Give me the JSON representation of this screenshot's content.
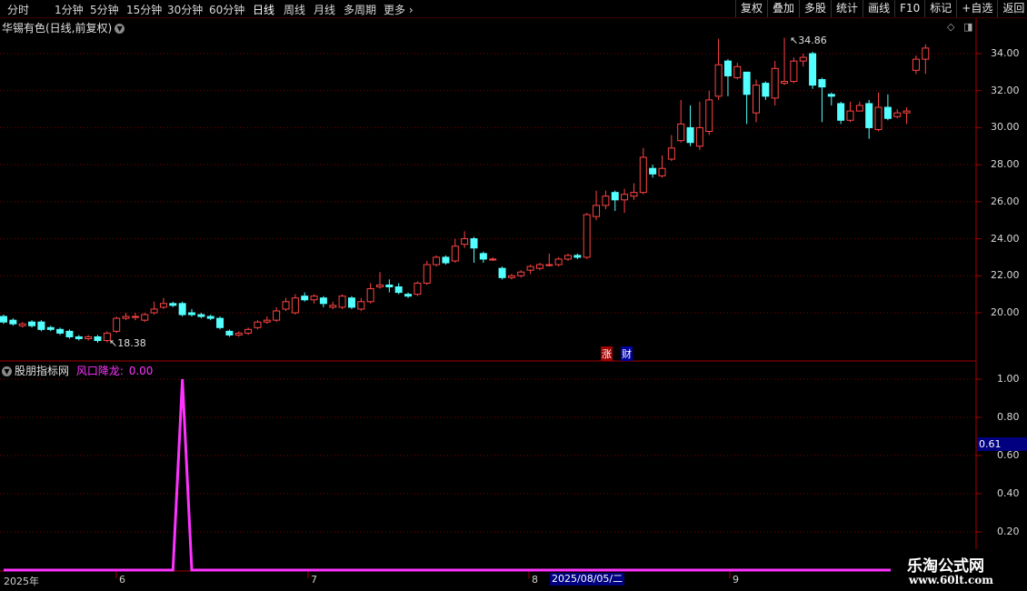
{
  "toolbar": {
    "periods": [
      "分时",
      "1分钟",
      "5分钟",
      "15分钟",
      "30分钟",
      "60分钟",
      "日线",
      "周线",
      "月线",
      "多周期",
      "更多"
    ],
    "active_period": "日线",
    "buttons": [
      "复权",
      "叠加",
      "多股",
      "统计",
      "画线",
      "F10",
      "标记",
      "+自选",
      "返回"
    ]
  },
  "chart": {
    "title": "华锡有色(日线,前复权)",
    "high_label": "34.86",
    "low_label": "18.38",
    "markers": [
      "涨",
      "财"
    ]
  },
  "price_axis": {
    "ticks": [
      "34.00",
      "32.00",
      "30.00",
      "28.00",
      "26.00",
      "24.00",
      "22.00",
      "20.00"
    ]
  },
  "indicator": {
    "source": "股朋指标网",
    "label": "风口降龙:",
    "value": "0.00",
    "axis_ticks": [
      "1.00",
      "0.80",
      "0.60",
      "0.40",
      "0.20"
    ],
    "current_value": "0.61"
  },
  "date_axis": {
    "labels": [
      "2025年",
      "6",
      "7",
      "8",
      "9"
    ],
    "current_date": "2025/08/05/二"
  },
  "watermark": {
    "title": "乐淘公式网",
    "url": "www.60lt.com"
  },
  "colors": {
    "up": "#ff4444",
    "down": "#54ffff",
    "indicator": "#ff33ff",
    "grid": "#800000"
  },
  "chart_data": {
    "type": "candlestick",
    "ylim": [
      18,
      35
    ],
    "candles": [
      [
        19.8,
        19.5,
        19.9,
        19.4
      ],
      [
        19.6,
        19.4,
        19.7,
        19.3
      ],
      [
        19.3,
        19.4,
        19.5,
        19.2
      ],
      [
        19.5,
        19.3,
        19.6,
        19.2
      ],
      [
        19.5,
        19.1,
        19.6,
        19.0
      ],
      [
        19.2,
        19.1,
        19.3,
        19.0
      ],
      [
        19.1,
        18.9,
        19.2,
        18.8
      ],
      [
        19.0,
        18.7,
        19.1,
        18.6
      ],
      [
        18.7,
        18.6,
        18.8,
        18.5
      ],
      [
        18.6,
        18.7,
        18.8,
        18.5
      ],
      [
        18.7,
        18.5,
        18.8,
        18.38
      ],
      [
        18.5,
        18.9,
        19.0,
        18.4
      ],
      [
        19.0,
        19.7,
        19.8,
        18.9
      ],
      [
        19.7,
        19.8,
        20.0,
        19.6
      ],
      [
        19.8,
        19.8,
        20.0,
        19.6
      ],
      [
        19.6,
        19.9,
        20.0,
        19.5
      ],
      [
        20.0,
        20.2,
        20.6,
        19.9
      ],
      [
        20.3,
        20.5,
        20.8,
        20.2
      ],
      [
        20.5,
        20.4,
        20.6,
        20.3
      ],
      [
        20.5,
        19.9,
        20.6,
        19.8
      ],
      [
        20.0,
        19.9,
        20.2,
        19.8
      ],
      [
        19.9,
        19.8,
        20.0,
        19.7
      ],
      [
        19.8,
        19.7,
        19.9,
        19.6
      ],
      [
        19.7,
        19.2,
        19.8,
        19.1
      ],
      [
        19.0,
        18.8,
        19.1,
        18.7
      ],
      [
        18.8,
        18.9,
        19.0,
        18.7
      ],
      [
        18.9,
        19.1,
        19.2,
        18.8
      ],
      [
        19.2,
        19.5,
        19.6,
        19.1
      ],
      [
        19.5,
        19.6,
        19.8,
        19.4
      ],
      [
        19.6,
        20.1,
        20.3,
        19.5
      ],
      [
        20.2,
        20.6,
        20.8,
        20.1
      ],
      [
        20.0,
        20.8,
        21.0,
        19.9
      ],
      [
        20.9,
        20.7,
        21.1,
        20.6
      ],
      [
        20.7,
        20.9,
        21.0,
        20.5
      ],
      [
        20.8,
        20.5,
        20.9,
        20.3
      ],
      [
        20.3,
        20.4,
        20.6,
        20.2
      ],
      [
        20.3,
        20.9,
        21.0,
        20.2
      ],
      [
        20.8,
        20.3,
        20.9,
        20.2
      ],
      [
        20.2,
        20.6,
        20.8,
        20.1
      ],
      [
        20.6,
        21.3,
        21.6,
        20.5
      ],
      [
        21.4,
        21.5,
        22.2,
        21.3
      ],
      [
        21.5,
        21.4,
        21.8,
        21.1
      ],
      [
        21.4,
        21.1,
        21.6,
        21.0
      ],
      [
        21.0,
        20.9,
        21.1,
        20.8
      ],
      [
        21.0,
        21.6,
        21.7,
        20.9
      ],
      [
        21.6,
        22.6,
        22.8,
        21.5
      ],
      [
        22.6,
        23.0,
        23.1,
        22.5
      ],
      [
        23.0,
        22.7,
        23.1,
        22.6
      ],
      [
        22.8,
        23.6,
        24.0,
        22.7
      ],
      [
        23.7,
        24.0,
        24.4,
        23.5
      ],
      [
        24.0,
        23.5,
        24.1,
        22.7
      ],
      [
        23.2,
        22.9,
        23.3,
        22.7
      ],
      [
        22.9,
        22.9,
        23.0,
        22.8
      ],
      [
        22.4,
        21.9,
        22.5,
        21.8
      ],
      [
        21.9,
        22.0,
        22.1,
        21.8
      ],
      [
        22.0,
        22.2,
        22.3,
        21.9
      ],
      [
        22.3,
        22.5,
        22.6,
        22.1
      ],
      [
        22.4,
        22.6,
        22.7,
        22.3
      ],
      [
        22.6,
        22.6,
        23.2,
        22.5
      ],
      [
        22.6,
        22.9,
        23.0,
        22.5
      ],
      [
        22.9,
        23.1,
        23.2,
        22.8
      ],
      [
        23.1,
        23.0,
        23.2,
        22.9
      ],
      [
        23.0,
        25.3,
        25.4,
        22.9
      ],
      [
        25.2,
        25.8,
        26.6,
        25.0
      ],
      [
        25.8,
        26.3,
        26.6,
        25.6
      ],
      [
        26.5,
        26.1,
        26.6,
        25.5
      ],
      [
        26.1,
        26.4,
        26.7,
        25.4
      ],
      [
        26.3,
        26.5,
        27.0,
        26.1
      ],
      [
        26.5,
        28.4,
        28.9,
        26.4
      ],
      [
        27.8,
        27.5,
        28.0,
        27.3
      ],
      [
        27.4,
        27.8,
        28.5,
        27.3
      ],
      [
        28.3,
        28.9,
        29.6,
        28.2
      ],
      [
        29.3,
        30.2,
        31.5,
        29.2
      ],
      [
        30.0,
        29.2,
        31.2,
        29.0
      ],
      [
        29.0,
        30.0,
        31.4,
        28.8
      ],
      [
        29.8,
        31.5,
        32.0,
        29.6
      ],
      [
        31.7,
        33.4,
        34.8,
        31.5
      ],
      [
        33.6,
        32.8,
        33.7,
        31.7
      ],
      [
        32.7,
        33.3,
        33.5,
        32.6
      ],
      [
        33.0,
        31.8,
        33.0,
        30.2
      ],
      [
        30.8,
        32.3,
        32.6,
        30.3
      ],
      [
        32.4,
        31.7,
        32.5,
        31.5
      ],
      [
        31.6,
        33.2,
        33.6,
        31.2
      ],
      [
        32.4,
        32.5,
        34.86,
        32.3
      ],
      [
        32.5,
        33.6,
        33.8,
        32.4
      ],
      [
        33.6,
        33.8,
        34.0,
        33.3
      ],
      [
        34.0,
        32.3,
        34.1,
        32.1
      ],
      [
        32.6,
        32.2,
        32.7,
        30.3
      ],
      [
        31.8,
        31.7,
        31.9,
        31.2
      ],
      [
        31.3,
        30.4,
        31.4,
        30.2
      ],
      [
        30.4,
        30.9,
        31.4,
        30.3
      ],
      [
        30.9,
        31.2,
        31.4,
        30.9
      ],
      [
        31.3,
        30.0,
        31.5,
        29.4
      ],
      [
        29.9,
        31.1,
        31.9,
        29.8
      ],
      [
        31.1,
        30.5,
        31.8,
        30.4
      ],
      [
        30.6,
        30.8,
        31.0,
        30.5
      ],
      [
        30.8,
        30.9,
        31.1,
        30.2
      ],
      [
        33.1,
        33.7,
        33.9,
        32.9
      ],
      [
        33.7,
        34.3,
        34.5,
        32.9
      ]
    ],
    "indicator_series": [
      0,
      0,
      0,
      0,
      0,
      0,
      0,
      0,
      0,
      0,
      0,
      0,
      0,
      0,
      0,
      0,
      0,
      0,
      0,
      1,
      0,
      0,
      0,
      0,
      0,
      0,
      0,
      0,
      0,
      0,
      0,
      0,
      0,
      0,
      0,
      0,
      0,
      0,
      0,
      0,
      0,
      0,
      0,
      0,
      0,
      0,
      0,
      0,
      0,
      0,
      0,
      0,
      0,
      0,
      0,
      0,
      0,
      0,
      0,
      0,
      0,
      0,
      0,
      0,
      0,
      0,
      0,
      0,
      0,
      0,
      0,
      0,
      0,
      0,
      0,
      0,
      0,
      0,
      0,
      0,
      0,
      0,
      0,
      0,
      0,
      0,
      0,
      0,
      0,
      0,
      0,
      0,
      0,
      0,
      0,
      0,
      0,
      0,
      0
    ]
  }
}
